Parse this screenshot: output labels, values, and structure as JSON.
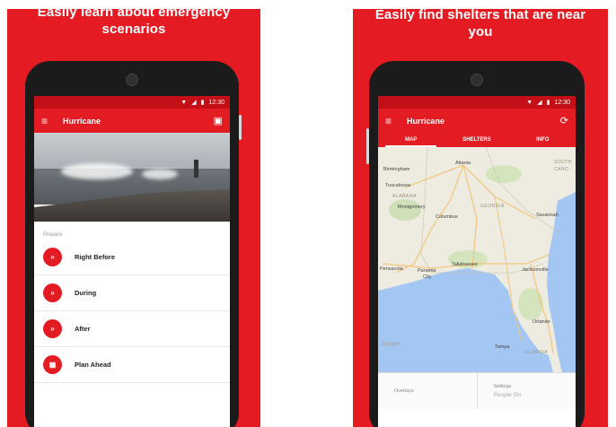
{
  "left": {
    "caption_line1": "Easily learn about emergency",
    "caption_line2": "scenarios",
    "status_time": "12:30",
    "app_title": "Hurricane",
    "section_label": "Prepare",
    "items": [
      {
        "label": "Right Before",
        "icon": "chevrons-icon"
      },
      {
        "label": "During",
        "icon": "chevrons-icon"
      },
      {
        "label": "After",
        "icon": "chevrons-icon"
      },
      {
        "label": "Plan Ahead",
        "icon": "calendar-icon"
      }
    ]
  },
  "right": {
    "caption_line1": "Easily find shelters that are near",
    "caption_line2": "you",
    "status_time": "12:30",
    "app_title": "Hurricane",
    "tabs": [
      "MAP",
      "SHELTERS",
      "INFO"
    ],
    "map_labels": {
      "atlanta": "Atlanta",
      "birmingham": "Birmingham",
      "tuscaloosa": "Tuscaloosa",
      "alabama": "ALABAMA",
      "montgomery": "Montgomery",
      "columbus": "Columbus",
      "georgia": "GEORGIA",
      "savannah": "Savannah",
      "tallahassee": "Tallahassee",
      "pensacola": "Pensacola",
      "panama": "Panama",
      "city": "City",
      "jacksonville": "Jacksonville",
      "orlando": "Orlando",
      "tampa": "Tampa",
      "florida": "FLORIDA",
      "south": "SOUTH",
      "caro": "CARO",
      "google": "Google"
    },
    "footer": {
      "overlays": "Overlays",
      "settings": "Settings",
      "settings_value": "People On"
    }
  },
  "colors": {
    "brand_red": "#e41b23",
    "status_red": "#c40f16"
  }
}
